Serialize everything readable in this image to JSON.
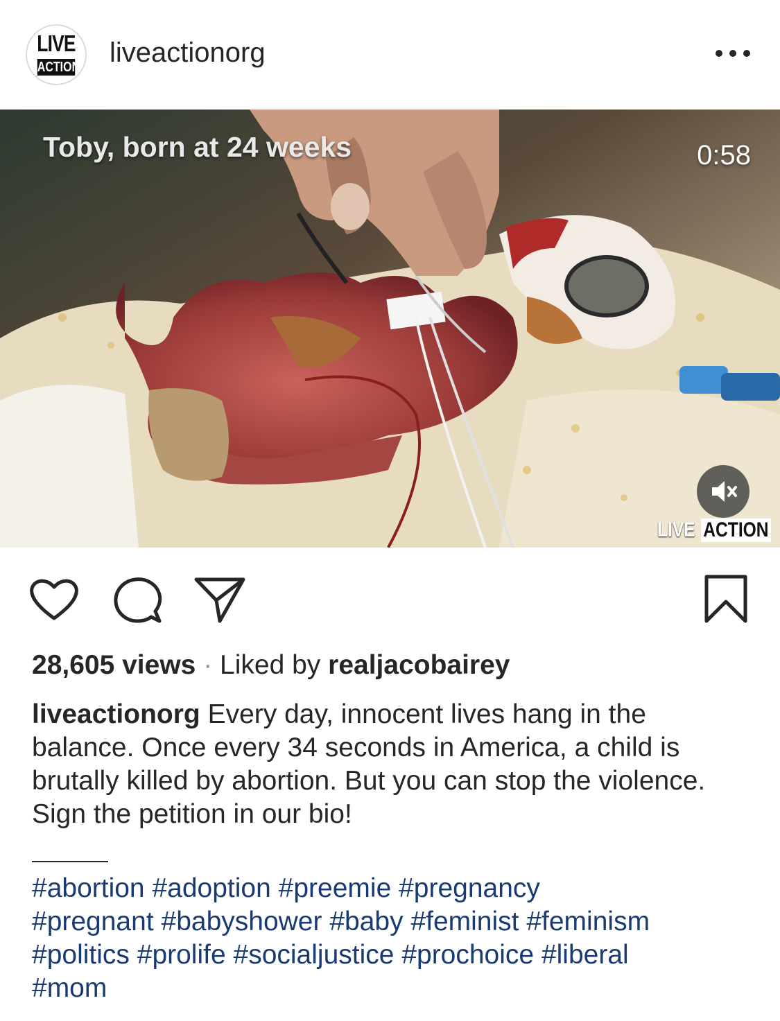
{
  "header": {
    "username": "liveactionorg",
    "logo_line1": "LIVE",
    "logo_line2": "ACTION",
    "more_icon": "more-horizontal-icon"
  },
  "video": {
    "overlay_caption": "Toby, born at 24 weeks",
    "time_remaining": "0:58",
    "muted": true,
    "mute_icon": "speaker-muted-icon",
    "watermark_live": "LIVE",
    "watermark_action": "ACTION"
  },
  "actions": {
    "like_icon": "heart-icon",
    "comment_icon": "comment-icon",
    "share_icon": "send-icon",
    "save_icon": "bookmark-icon"
  },
  "meta": {
    "views": "28,605 views",
    "separator": " · ",
    "liked_by_prefix": "Liked by ",
    "liked_by_user": "realjacobairey"
  },
  "caption": {
    "user": "liveactionorg",
    "text": "Every day, innocent lives hang in the balance. Once every 34 seconds in America, a child is brutally killed by abortion. But you can stop the violence. Sign the petition in our bio!"
  },
  "hashtags": [
    "#abortion",
    "#adoption",
    "#preemie",
    "#pregnancy",
    "#pregnant",
    "#babyshower",
    "#baby",
    "#feminist",
    "#feminism",
    "#politics",
    "#prolife",
    "#socialjustice",
    "#prochoice",
    "#liberal",
    "#mom"
  ],
  "colors": {
    "text": "#262626",
    "hashtag": "#1a3a73",
    "divider": "#dbdbdb"
  }
}
